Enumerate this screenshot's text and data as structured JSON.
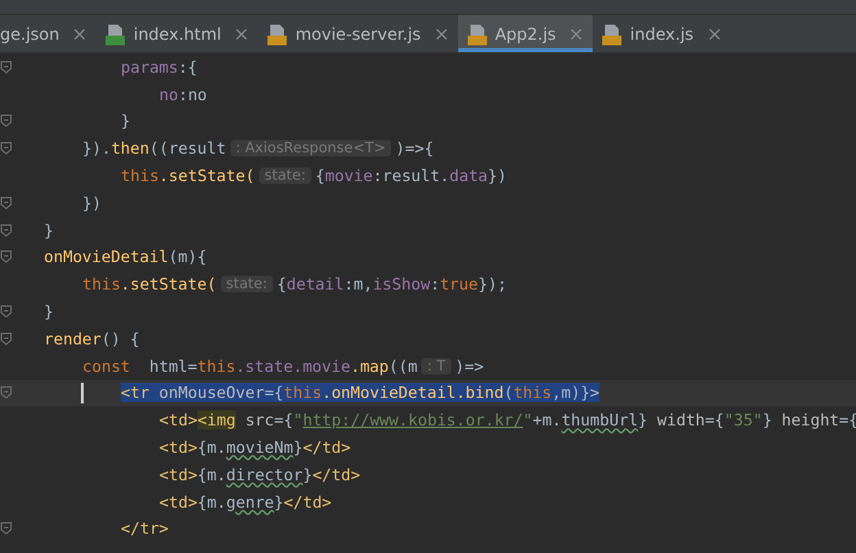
{
  "tabs": [
    {
      "label": "ge.json",
      "selected": false
    },
    {
      "label": "index.html",
      "kind": "html",
      "selected": false
    },
    {
      "label": "movie-server.js",
      "kind": "js",
      "selected": false
    },
    {
      "label": "App2.js",
      "kind": "js",
      "selected": true
    },
    {
      "label": "index.js",
      "kind": "js",
      "selected": false
    }
  ],
  "lines": [
    {
      "children": [
        {
          "children": [
            {
              "fold": true,
              "current": false,
              "parts": [
                {
                  "kind": "code",
                  "tokens": [
                    {
                      "t": "params",
                      "kind": "prop"
                    },
                    {
                      "t": ":{",
                      "kind": "plain"
                    }
                  ]
                }
              ],
              "children": [
                {
                  "fold": false,
                  "current": false,
                  "parts": [
                    {
                      "kind": "code",
                      "tokens": [
                        {
                          "t": "no",
                          "kind": "prop"
                        },
                        {
                          "t": ":no",
                          "kind": "plain"
                        }
                      ]
                    }
                  ]
                }
              ]
            },
            {
              "fold": true,
              "current": false,
              "parts": [
                {
                  "kind": "code",
                  "tokens": [
                    {
                      "t": "}",
                      "kind": "plain"
                    }
                  ]
                }
              ]
            }
          ]
        },
        {
          "fold": true,
          "current": false,
          "parts": [
            {
              "kind": "code",
              "tokens": [
                {
                  "t": "}).",
                  "kind": "plain"
                },
                {
                  "t": "then",
                  "kind": "func"
                },
                {
                  "t": "((result",
                  "kind": "plain"
                }
              ]
            },
            {
              "kind": "hint",
              "text": ": AxiosResponse<T>"
            },
            {
              "kind": "code",
              "tokens": [
                {
                  "t": ")=>{",
                  "kind": "plain"
                }
              ]
            }
          ],
          "children": [
            {
              "fold": false,
              "current": false,
              "parts": [
                {
                  "kind": "code",
                  "tokens": [
                    {
                      "t": "this",
                      "kind": "keyword"
                    },
                    {
                      "t": ".setState(",
                      "kind": "func"
                    }
                  ]
                },
                {
                  "kind": "hint",
                  "text": "state:"
                },
                {
                  "kind": "code",
                  "tokens": [
                    {
                      "t": "{",
                      "kind": "plain"
                    },
                    {
                      "t": "movie",
                      "kind": "prop"
                    },
                    {
                      "t": ":result.",
                      "kind": "plain"
                    },
                    {
                      "t": "data",
                      "kind": "prop"
                    },
                    {
                      "t": "})",
                      "kind": "plain"
                    }
                  ]
                }
              ]
            }
          ]
        },
        {
          "fold": true,
          "current": false,
          "parts": [
            {
              "kind": "code",
              "tokens": [
                {
                  "t": "})",
                  "kind": "plain"
                }
              ]
            }
          ]
        }
      ]
    },
    {
      "fold": true,
      "current": false,
      "parts": [
        {
          "kind": "code",
          "tokens": [
            {
              "t": "}",
              "kind": "plain"
            }
          ]
        }
      ]
    },
    {
      "fold": true,
      "current": false,
      "parts": [
        {
          "kind": "code",
          "tokens": [
            {
              "t": "onMovieDetail",
              "kind": "func"
            },
            {
              "t": "(m){",
              "kind": "plain"
            }
          ]
        }
      ],
      "children": [
        {
          "fold": false,
          "current": false,
          "parts": [
            {
              "kind": "code",
              "tokens": [
                {
                  "t": "this",
                  "kind": "keyword"
                },
                {
                  "t": ".setState(",
                  "kind": "func"
                }
              ]
            },
            {
              "kind": "hint",
              "text": "state:"
            },
            {
              "kind": "code",
              "tokens": [
                {
                  "t": "{",
                  "kind": "plain"
                },
                {
                  "t": "detail",
                  "kind": "prop"
                },
                {
                  "t": ":m,",
                  "kind": "plain"
                },
                {
                  "t": "isShow",
                  "kind": "prop"
                },
                {
                  "t": ":",
                  "kind": "plain"
                },
                {
                  "t": "true",
                  "kind": "keyword"
                },
                {
                  "t": "});",
                  "kind": "plain"
                }
              ]
            }
          ]
        }
      ]
    },
    {
      "fold": true,
      "current": false,
      "parts": [
        {
          "kind": "code",
          "tokens": [
            {
              "t": "}",
              "kind": "plain"
            }
          ]
        }
      ]
    },
    {
      "fold": true,
      "current": false,
      "parts": [
        {
          "kind": "code",
          "tokens": [
            {
              "t": "render",
              "kind": "func"
            },
            {
              "t": "() {",
              "kind": "plain"
            }
          ]
        }
      ],
      "children": [
        {
          "fold": false,
          "current": false,
          "parts": [
            {
              "kind": "code",
              "tokens": [
                {
                  "t": "const",
                  "kind": "keyword"
                },
                {
                  "t": "  html=",
                  "kind": "plain"
                },
                {
                  "t": "this",
                  "kind": "keyword"
                },
                {
                  "t": ".state.movie",
                  "kind": "prop"
                },
                {
                  "t": ".map",
                  "kind": "func"
                },
                {
                  "t": "((m",
                  "kind": "plain"
                }
              ]
            },
            {
              "kind": "hint",
              "text": ": T"
            },
            {
              "kind": "code",
              "tokens": [
                {
                  "t": ")=>",
                  "kind": "plain"
                }
              ]
            }
          ],
          "children": [
            {
              "fold": true,
              "current": true,
              "parts": [
                {
                  "kind": "selection",
                  "tokens": [
                    {
                      "t": "<tr ",
                      "kind": "tag"
                    },
                    {
                      "t": "onMouseOver",
                      "kind": "attr"
                    },
                    {
                      "t": "={",
                      "kind": "plain"
                    },
                    {
                      "t": "this",
                      "kind": "keyword"
                    },
                    {
                      "t": ".onMovieDetail.bind",
                      "kind": "func"
                    },
                    {
                      "t": "(",
                      "kind": "plain"
                    },
                    {
                      "t": "this",
                      "kind": "keyword"
                    },
                    {
                      "t": ",m)}>",
                      "kind": "plain"
                    }
                  ]
                }
              ],
              "children": [
                {
                  "fold": false,
                  "current": false,
                  "parts": [
                    {
                      "kind": "code",
                      "tokens": [
                        {
                          "t": "<td>",
                          "kind": "tag"
                        },
                        {
                          "t": "<img",
                          "kind": "match"
                        },
                        {
                          "t": " src",
                          "kind": "attr"
                        },
                        {
                          "t": "={",
                          "kind": "plain"
                        },
                        {
                          "t": "\"",
                          "kind": "string"
                        },
                        {
                          "t": "http://www.kobis.or.kr/",
                          "kind": "url"
                        },
                        {
                          "t": "\"",
                          "kind": "string"
                        },
                        {
                          "t": "+m.",
                          "kind": "plain"
                        },
                        {
                          "t": "thumbUrl",
                          "kind": "typo"
                        },
                        {
                          "t": "} ",
                          "kind": "plain"
                        },
                        {
                          "t": "width",
                          "kind": "attr"
                        },
                        {
                          "t": "={",
                          "kind": "plain"
                        },
                        {
                          "t": "\"35\"",
                          "kind": "string"
                        },
                        {
                          "t": "} ",
                          "kind": "plain"
                        },
                        {
                          "t": "height",
                          "kind": "attr"
                        },
                        {
                          "t": "={",
                          "kind": "plain"
                        }
                      ]
                    }
                  ]
                },
                {
                  "fold": false,
                  "current": false,
                  "parts": [
                    {
                      "kind": "code",
                      "tokens": [
                        {
                          "t": "<td>",
                          "kind": "tag"
                        },
                        {
                          "t": "{m.",
                          "kind": "plain"
                        },
                        {
                          "t": "movieNm",
                          "kind": "typo"
                        },
                        {
                          "t": "}",
                          "kind": "plain"
                        },
                        {
                          "t": "</td>",
                          "kind": "tag"
                        }
                      ]
                    }
                  ]
                },
                {
                  "fold": false,
                  "current": false,
                  "parts": [
                    {
                      "kind": "code",
                      "tokens": [
                        {
                          "t": "<td>",
                          "kind": "tag"
                        },
                        {
                          "t": "{m.",
                          "kind": "plain"
                        },
                        {
                          "t": "director",
                          "kind": "typo"
                        },
                        {
                          "t": "}",
                          "kind": "plain"
                        },
                        {
                          "t": "</td>",
                          "kind": "tag"
                        }
                      ]
                    }
                  ]
                },
                {
                  "fold": false,
                  "current": false,
                  "parts": [
                    {
                      "kind": "code",
                      "tokens": [
                        {
                          "t": "<td>",
                          "kind": "tag"
                        },
                        {
                          "t": "{m.",
                          "kind": "plain"
                        },
                        {
                          "t": "genre",
                          "kind": "typo"
                        },
                        {
                          "t": "}",
                          "kind": "plain"
                        },
                        {
                          "t": "</td>",
                          "kind": "tag"
                        }
                      ]
                    }
                  ]
                }
              ]
            },
            {
              "fold": true,
              "current": false,
              "parts": [
                {
                  "kind": "code",
                  "tokens": [
                    {
                      "t": "</tr>",
                      "kind": "tag"
                    }
                  ]
                }
              ]
            }
          ]
        }
      ]
    }
  ]
}
